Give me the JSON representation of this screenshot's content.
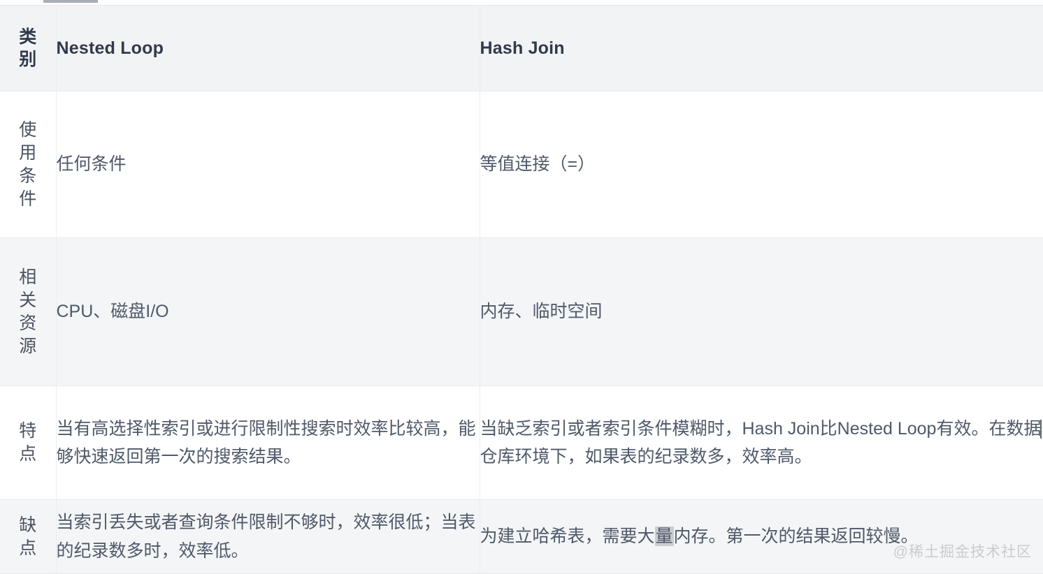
{
  "table": {
    "columns": [
      {
        "key": "category",
        "label": "类别"
      },
      {
        "key": "nested_loop",
        "label": "Nested Loop"
      },
      {
        "key": "hash_join",
        "label": "Hash Join"
      }
    ],
    "rows": [
      {
        "category": "使用条件",
        "nested_loop": "任何条件",
        "hash_join": "等值连接（=）"
      },
      {
        "category": "相关资源",
        "nested_loop": "CPU、磁盘I/O",
        "hash_join": "内存、临时空间"
      },
      {
        "category": "特点",
        "nested_loop": "当有高选择性索引或进行限制性搜索时效率比较高，能够快速返回第一次的搜索结果。",
        "hash_join_part1": "当缺乏索引或者索引条件模糊时，Hash Join比Nested Loop有效。在数据",
        "hash_join_part2": "仓库环境下，如果表的纪录数多，效率高。"
      },
      {
        "category": "缺点",
        "nested_loop": "当索引丢失或者查询条件限制不够时，效率很低；当表的纪录数多时，效率低。",
        "hash_join_part1": "为建立哈希表，需要大",
        "hash_join_blob": "量",
        "hash_join_part2": "内存。第一次的结果返回较慢。"
      }
    ]
  },
  "watermark": {
    "text": "@稀土掘金技术社区"
  },
  "colors": {
    "header_bg": "#f2f3f4",
    "zebra_bg": "#f4f5f6",
    "row_bg": "#ffffff",
    "border": "#e8eaed",
    "text": "#4e5969",
    "header_text": "#303a4b",
    "watermark_text": "#c9ccd0"
  }
}
